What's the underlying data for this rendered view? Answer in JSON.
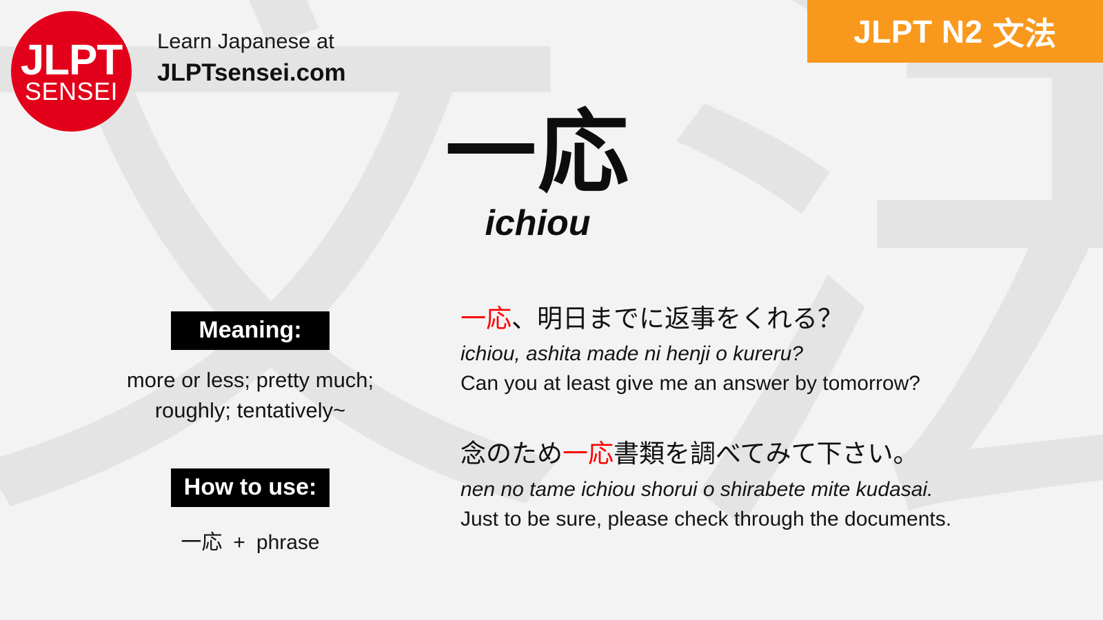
{
  "header": {
    "logo": {
      "top_text": "JLPT",
      "bottom_text": "SENSEI",
      "color": "#e2001a"
    },
    "tagline_line1": "Learn Japanese at",
    "tagline_line2": "JLPTsensei.com",
    "badge": {
      "level": "JLPT N2",
      "category_jp": "文法",
      "color": "#f8991d"
    }
  },
  "title": {
    "kanji": "一応",
    "romaji": "ichiou"
  },
  "meaning": {
    "label": "Meaning:",
    "line1": "more or less; pretty much;",
    "line2": "roughly; tentatively~"
  },
  "how_to_use": {
    "label": "How to use:",
    "term": "一応",
    "plus": "+",
    "placeholder": "phrase"
  },
  "highlight_color": "#ff0000",
  "examples": [
    {
      "jp_before": "",
      "jp_highlight": "一応",
      "jp_after": "、明日までに返事をくれる？",
      "romaji": "ichiou, ashita made ni henji o kureru?",
      "english": "Can you at least give me an answer by tomorrow?"
    },
    {
      "jp_before": "念のため",
      "jp_highlight": "一応",
      "jp_after": "書類を調べてみて下さい。",
      "romaji": "nen no tame ichiou shorui o shirabete mite kudasai.",
      "english": "Just to be sure, please check through the documents."
    }
  ],
  "background_watermark": {
    "left_char": "文",
    "right_char": "法"
  }
}
